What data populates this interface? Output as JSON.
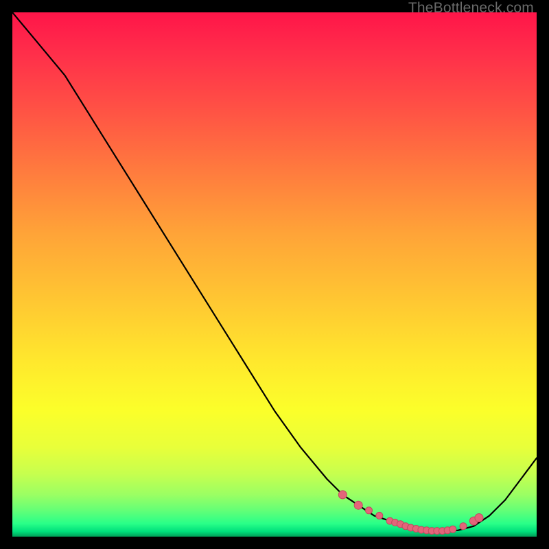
{
  "watermark": "TheBottleneck.com",
  "chart_data": {
    "type": "line",
    "title": "",
    "xlabel": "",
    "ylabel": "",
    "xlim": [
      0,
      100
    ],
    "ylim": [
      0,
      100
    ],
    "grid": false,
    "legend": false,
    "series": [
      {
        "name": "bottleneck-curve",
        "x": [
          0,
          5,
          10,
          15,
          20,
          25,
          30,
          35,
          40,
          45,
          50,
          55,
          60,
          63,
          66,
          69,
          72,
          75,
          78,
          81,
          83,
          85,
          88,
          91,
          94,
          97,
          100
        ],
        "y": [
          100,
          94,
          88,
          80,
          72,
          64,
          56,
          48,
          40,
          32,
          24,
          17,
          11,
          8,
          6,
          4,
          3,
          2,
          1.5,
          1.2,
          1.1,
          1.2,
          2,
          4,
          7,
          11,
          15
        ]
      }
    ],
    "highlight_points": {
      "name": "green-zone-dots",
      "x": [
        63,
        66,
        68,
        70,
        72,
        73,
        74,
        75,
        76,
        77,
        78,
        79,
        80,
        81,
        82,
        83,
        84,
        86,
        88,
        89
      ],
      "y": [
        8,
        6,
        5,
        4,
        3,
        2.7,
        2.4,
        2,
        1.7,
        1.5,
        1.3,
        1.2,
        1.1,
        1.1,
        1.1,
        1.2,
        1.4,
        2,
        3,
        3.6
      ]
    },
    "background_gradient": {
      "orientation": "vertical",
      "stops": [
        {
          "pos": 0.0,
          "color": "#ff1549"
        },
        {
          "pos": 0.3,
          "color": "#ff7a3e"
        },
        {
          "pos": 0.67,
          "color": "#ffe92d"
        },
        {
          "pos": 0.92,
          "color": "#9bff63"
        },
        {
          "pos": 1.0,
          "color": "#009e58"
        }
      ]
    }
  }
}
